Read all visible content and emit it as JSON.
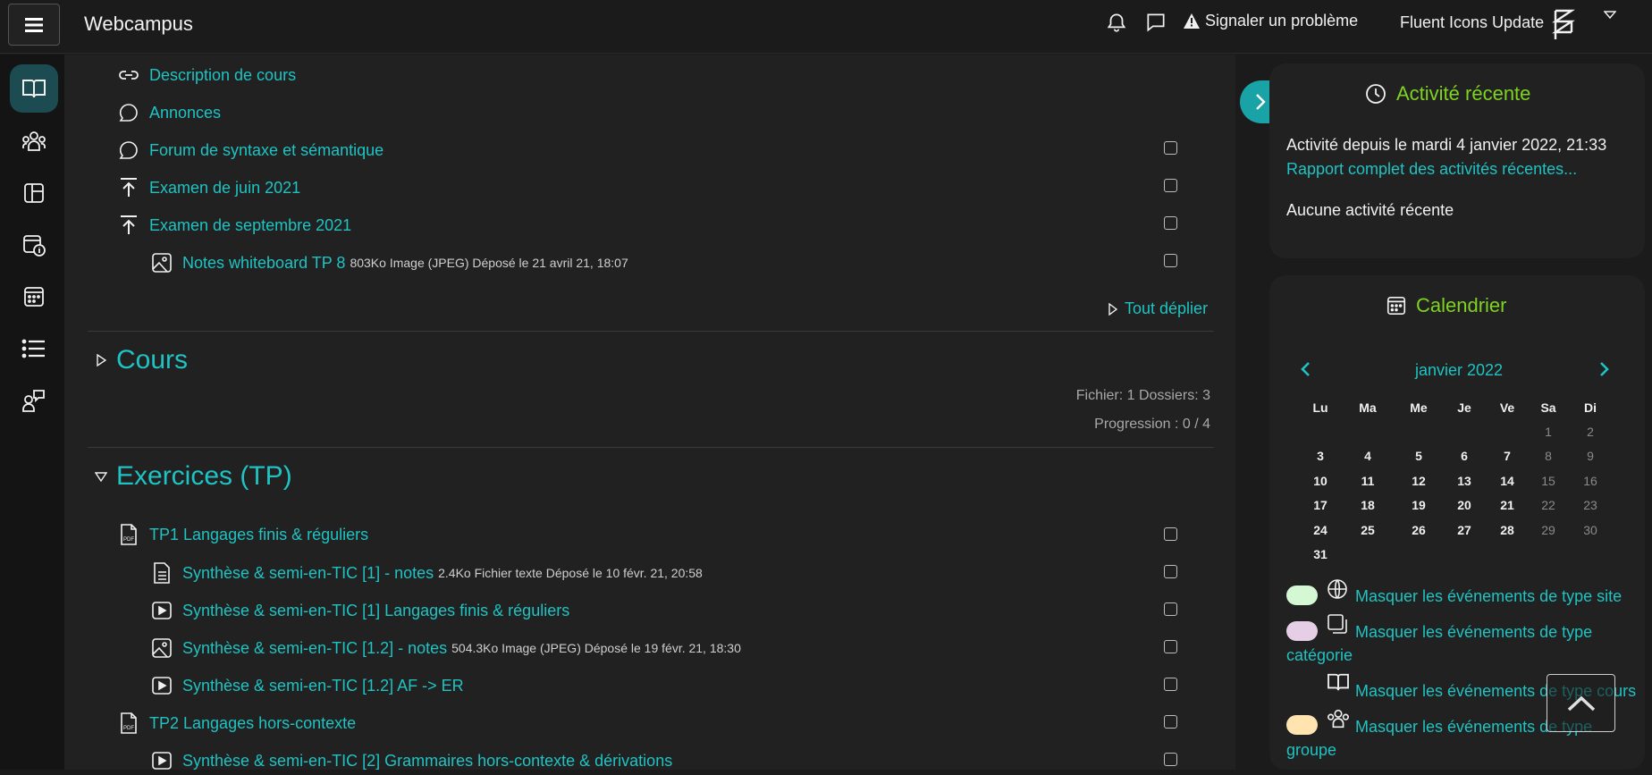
{
  "header": {
    "brand": "Webcampus",
    "report_label": "Signaler un problème",
    "user_name": "Fluent Icons Update"
  },
  "rail": {
    "icons": [
      "book-icon",
      "people-icon",
      "layout-icon",
      "info-calendar-icon",
      "calendar-icon",
      "list-icon",
      "chat-people-icon"
    ]
  },
  "top_items": [
    {
      "icon": "link-icon",
      "label": "Description de cours",
      "meta": "",
      "checkbox": false
    },
    {
      "icon": "chat-icon",
      "label": "Annonces",
      "meta": "",
      "checkbox": false
    },
    {
      "icon": "chat-icon",
      "label": "Forum de syntaxe et sémantique",
      "meta": "",
      "checkbox": true
    },
    {
      "icon": "upload-icon",
      "label": "Examen de juin 2021",
      "meta": "",
      "checkbox": true
    },
    {
      "icon": "upload-icon",
      "label": "Examen de septembre 2021",
      "meta": "",
      "checkbox": true
    },
    {
      "icon": "image-icon",
      "label": "Notes whiteboard TP 8",
      "meta": "803Ko Image (JPEG) Déposé le 21 avril 21, 18:07",
      "checkbox": true
    }
  ],
  "expand_all": "Tout déplier",
  "section_cours": {
    "title": "Cours",
    "files": "Fichier: 1  Dossiers: 3",
    "progress": "Progression : 0 / 4"
  },
  "section_ex": {
    "title": "Exercices (TP)",
    "items": [
      {
        "icon": "pdf-icon",
        "label": "TP1 Langages finis & réguliers",
        "meta": ""
      },
      {
        "icon": "document-icon",
        "label": "Synthèse & semi-en-TIC [1] - notes",
        "meta": "2.4Ko Fichier texte Déposé le 10 févr. 21, 20:58"
      },
      {
        "icon": "video-icon",
        "label": "Synthèse & semi-en-TIC [1] Langages finis & réguliers",
        "meta": ""
      },
      {
        "icon": "image-icon",
        "label": "Synthèse & semi-en-TIC [1.2] - notes",
        "meta": "504.3Ko Image (JPEG) Déposé le 19 févr. 21, 18:30"
      },
      {
        "icon": "video-icon",
        "label": "Synthèse & semi-en-TIC [1.2] AF -> ER",
        "meta": ""
      },
      {
        "icon": "pdf-icon",
        "label": "TP2 Langages hors-contexte",
        "meta": ""
      },
      {
        "icon": "video-icon",
        "label": "Synthèse & semi-en-TIC [2] Grammaires hors-contexte & dérivations",
        "meta": ""
      }
    ]
  },
  "recent": {
    "title": "Activité récente",
    "since": "Activité depuis le mardi 4 janvier 2022, 21:33",
    "full_report": "Rapport complet des activités récentes...",
    "none": "Aucune activité récente"
  },
  "calendar": {
    "title": "Calendrier",
    "month": "janvier 2022",
    "days_header": [
      "Lu",
      "Ma",
      "Me",
      "Je",
      "Ve",
      "Sa",
      "Di"
    ],
    "weeks": [
      [
        "",
        "",
        "",
        "",
        "",
        "1",
        "2"
      ],
      [
        "3",
        "4",
        "5",
        "6",
        "7",
        "8",
        "9"
      ],
      [
        "10",
        "11",
        "12",
        "13",
        "14",
        "15",
        "16"
      ],
      [
        "17",
        "18",
        "19",
        "20",
        "21",
        "22",
        "23"
      ],
      [
        "24",
        "25",
        "26",
        "27",
        "28",
        "29",
        "30"
      ],
      [
        "31",
        "",
        "",
        "",
        "",
        "",
        ""
      ]
    ],
    "legend": {
      "site": "Masquer les événements de type site",
      "category_a": "Masquer les événements de type",
      "category_b": "catégorie",
      "course": "Masquer les événements de type cours",
      "group_a": "Masquer les événements de type",
      "group_b": "groupe"
    },
    "colors": {
      "site": "#d4f7d4",
      "category": "#e6cfe6",
      "group": "#ffe4b0"
    }
  }
}
